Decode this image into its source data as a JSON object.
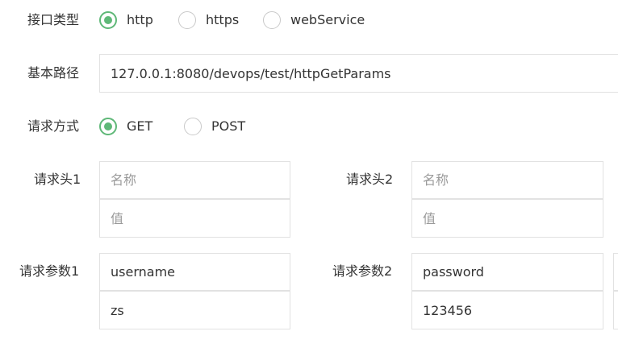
{
  "interface_type": {
    "label": "接口类型",
    "options": [
      {
        "label": "http",
        "checked": true
      },
      {
        "label": "https",
        "checked": false
      },
      {
        "label": "webService",
        "checked": false
      }
    ]
  },
  "base_path": {
    "label": "基本路径",
    "value": "127.0.0.1:8080/devops/test/httpGetParams"
  },
  "request_method": {
    "label": "请求方式",
    "options": [
      {
        "label": "GET",
        "checked": true
      },
      {
        "label": "POST",
        "checked": false
      }
    ]
  },
  "headers": [
    {
      "label": "请求头1",
      "name_value": "",
      "name_placeholder": "名称",
      "value_value": "",
      "value_placeholder": "值"
    },
    {
      "label": "请求头2",
      "name_value": "",
      "name_placeholder": "名称",
      "value_value": "",
      "value_placeholder": "值"
    }
  ],
  "params": [
    {
      "label": "请求参数1",
      "name_value": "username",
      "value_value": "zs"
    },
    {
      "label": "请求参数2",
      "name_value": "password",
      "value_value": "123456"
    }
  ],
  "colors": {
    "accent": "#5FB878",
    "border": "#e2e2e2",
    "text": "#333333",
    "placeholder": "#9a9a9a"
  }
}
